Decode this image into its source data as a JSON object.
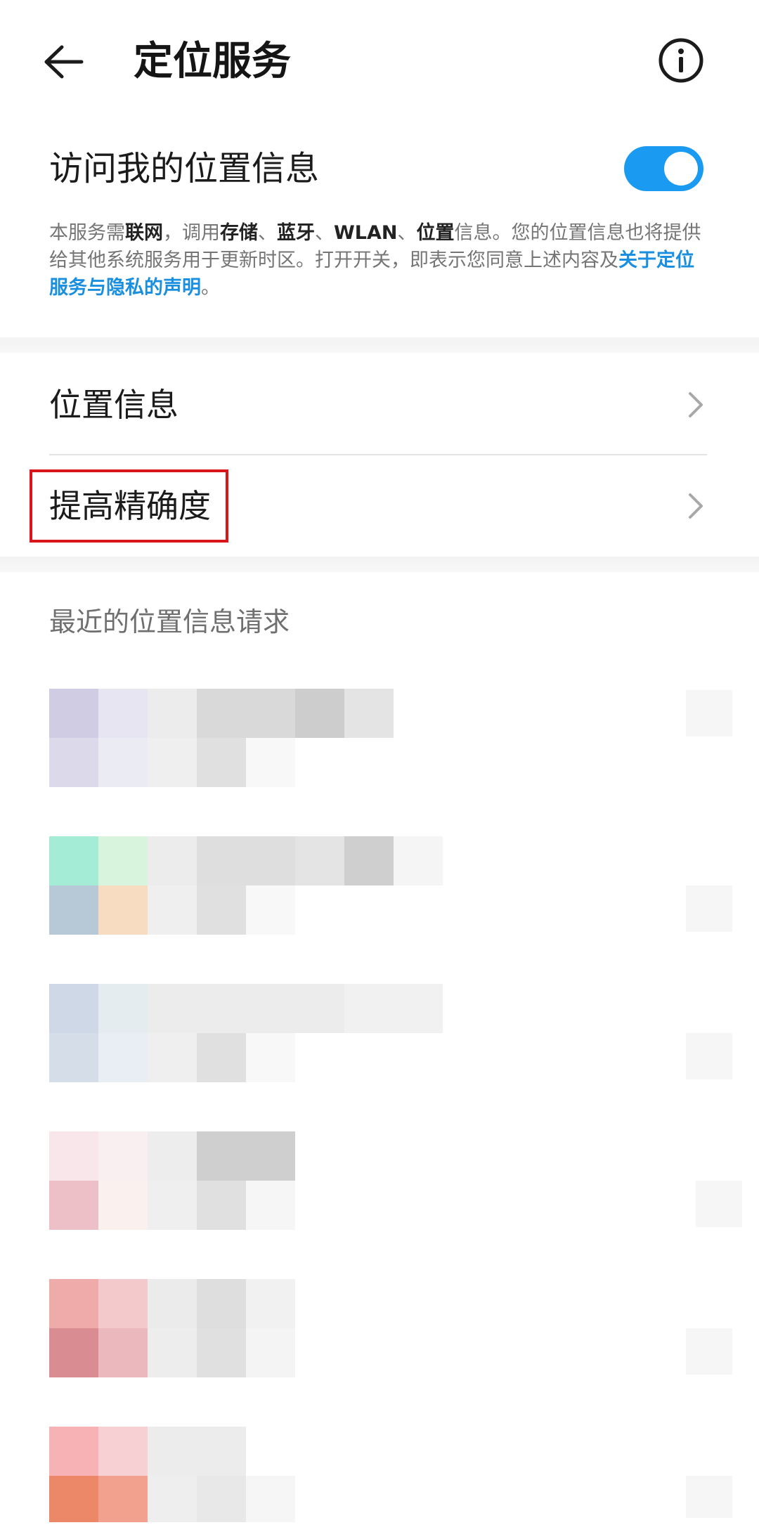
{
  "header": {
    "title": "定位服务",
    "back_icon": "arrow-left-icon",
    "info_icon": "info-circle-icon"
  },
  "location_access": {
    "label": "访问我的位置信息",
    "enabled": true,
    "description": {
      "t1": "本服务需",
      "b1": "联网",
      "t2": "，调用",
      "b2": "存储",
      "t3": "、",
      "b3": "蓝牙",
      "t4": "、",
      "b4": "WLAN",
      "t5": "、",
      "b5": "位置",
      "t6": "信息。您的位置信息也将提供给其他系统服务用于更新时区。打开开关，即表示您同意上述内容及",
      "link": "关于定位服务与隐私的声明",
      "t7": "。"
    }
  },
  "menu": {
    "items": [
      {
        "label": "位置信息",
        "icon": "chevron-right-icon"
      },
      {
        "label": "提高精确度",
        "icon": "chevron-right-icon"
      }
    ]
  },
  "recent": {
    "section_title": "最近的位置信息请求"
  },
  "colors": {
    "accent": "#1a9af0",
    "link": "#1a8fe0",
    "highlight_border": "#d8161b"
  }
}
